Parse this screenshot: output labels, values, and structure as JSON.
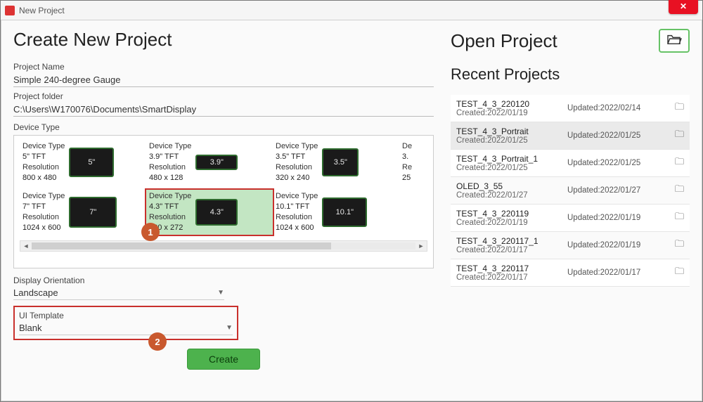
{
  "window": {
    "title": "New Project"
  },
  "left": {
    "heading": "Create New Project",
    "projectNameLabel": "Project Name",
    "projectName": "Simple 240-degree Gauge",
    "projectFolderLabel": "Project folder",
    "projectFolder": "C:\\Users\\W170076\\Documents\\SmartDisplay",
    "deviceTypeLabel": "Device Type",
    "resolutionLabel": "Resolution",
    "devices_row1": [
      {
        "type": "5\" TFT",
        "res": "800 x 480",
        "thumb": "5\""
      },
      {
        "type": "3.9\" TFT",
        "res": "480 x 128",
        "thumb": "3.9\""
      },
      {
        "type": "3.5\" TFT",
        "res": "320 x 240",
        "thumb": "3.5\""
      },
      {
        "type": "3.",
        "res": "25",
        "thumb": ""
      }
    ],
    "devices_row2": [
      {
        "type": "7\" TFT",
        "res": "1024 x 600",
        "thumb": "7\""
      },
      {
        "type": "4.3\" TFT",
        "res": "480 x 272",
        "thumb": "4.3\"",
        "selected": true
      },
      {
        "type": "10.1\" TFT",
        "res": "1024 x 600",
        "thumb": "10.1\""
      }
    ],
    "orientationLabel": "Display Orientation",
    "orientationValue": "Landscape",
    "uiTemplateLabel": "UI Template",
    "uiTemplateValue": "Blank",
    "createLabel": "Create",
    "badge1": "1",
    "badge2": "2"
  },
  "right": {
    "openHeading": "Open Project",
    "recentHeading": "Recent Projects",
    "items": [
      {
        "name": "TEST_4_3_220120",
        "created": "Created:2022/01/19",
        "updated": "Updated:2022/02/14"
      },
      {
        "name": "TEST_4_3_Portrait",
        "created": "Created:2022/01/25",
        "updated": "Updated:2022/01/25",
        "hl": true
      },
      {
        "name": "TEST_4_3_Portrait_1",
        "created": "Created:2022/01/25",
        "updated": "Updated:2022/01/25"
      },
      {
        "name": "OLED_3_55",
        "created": "Created:2022/01/27",
        "updated": "Updated:2022/01/27"
      },
      {
        "name": "TEST_4_3_220119",
        "created": "Created:2022/01/19",
        "updated": "Updated:2022/01/19"
      },
      {
        "name": "TEST_4_3_220117_1",
        "created": "Created:2022/01/17",
        "updated": "Updated:2022/01/19"
      },
      {
        "name": "TEST_4_3_220117",
        "created": "Created:2022/01/17",
        "updated": "Updated:2022/01/17"
      }
    ]
  }
}
